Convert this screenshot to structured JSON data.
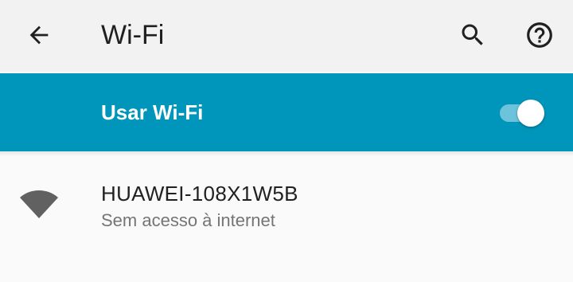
{
  "header": {
    "title": "Wi-Fi",
    "back_icon": "arrow-back-icon",
    "search_icon": "search-icon",
    "help_icon": "help-icon"
  },
  "master_switch": {
    "label": "Usar Wi-Fi",
    "enabled": true,
    "bar_color": "#0096bb"
  },
  "networks": [
    {
      "ssid": "HUAWEI-108X1W5B",
      "status": "Sem acesso à internet",
      "signal_icon": "wifi-signal-icon"
    }
  ]
}
